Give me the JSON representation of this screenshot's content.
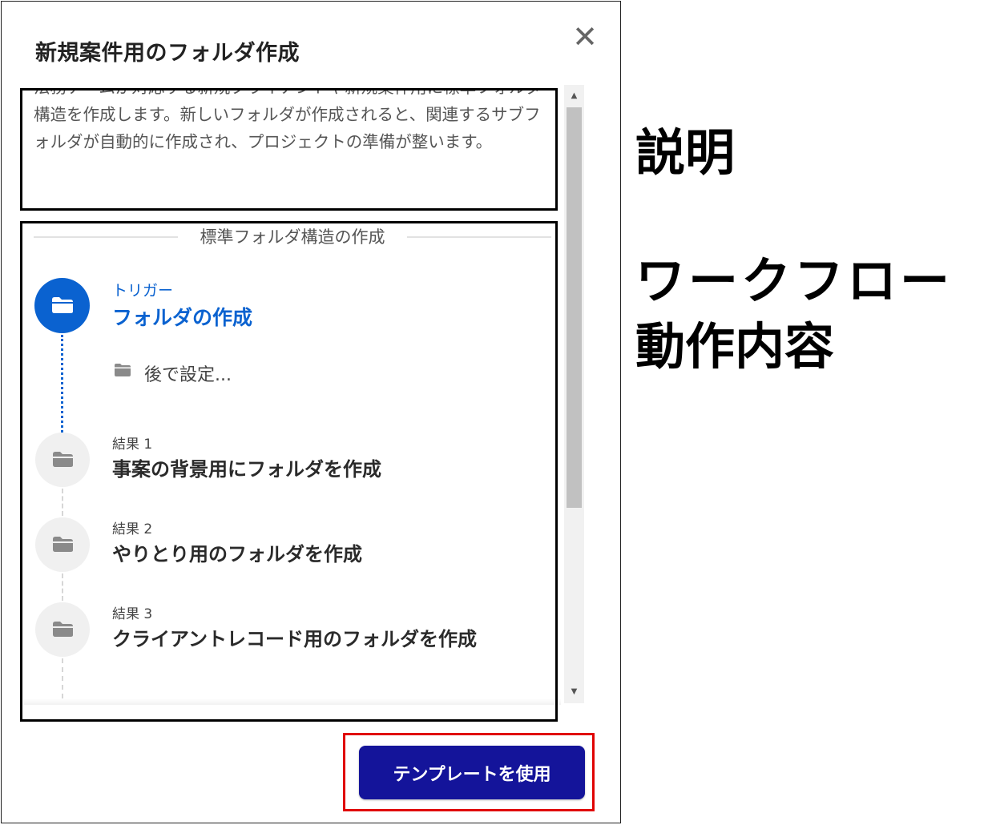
{
  "dialog": {
    "title": "新規案件用のフォルダ作成",
    "close_icon": "close-icon",
    "description": "法務チームが対応する新規クライアントや新規案件用に標準フォルダ構造を作成します。新しいフォルダが作成されると、関連するサブフォルダが自動的に作成され、プロジェクトの準備が整います。"
  },
  "workflow": {
    "section_title": "標準フォルダ構造の作成",
    "trigger": {
      "label": "トリガー",
      "title": "フォルダの作成",
      "setting": "後で設定...",
      "icon": "folder-icon"
    },
    "results": [
      {
        "label": "結果 1",
        "title": "事案の背景用にフォルダを作成",
        "icon": "folder-icon"
      },
      {
        "label": "結果 2",
        "title": "やりとり用のフォルダを作成",
        "icon": "folder-icon"
      },
      {
        "label": "結果 3",
        "title": "クライアントレコード用のフォルダを作成",
        "icon": "folder-icon"
      }
    ]
  },
  "footer": {
    "primary_button": "テンプレートを使用"
  },
  "annotations": {
    "description_label": "説明",
    "workflow_label_line1": "ワークフロー",
    "workflow_label_line2": "動作内容"
  },
  "colors": {
    "accent_blue": "#0a62d0",
    "button_navy": "#14149a",
    "annotation_red": "#e00000"
  }
}
